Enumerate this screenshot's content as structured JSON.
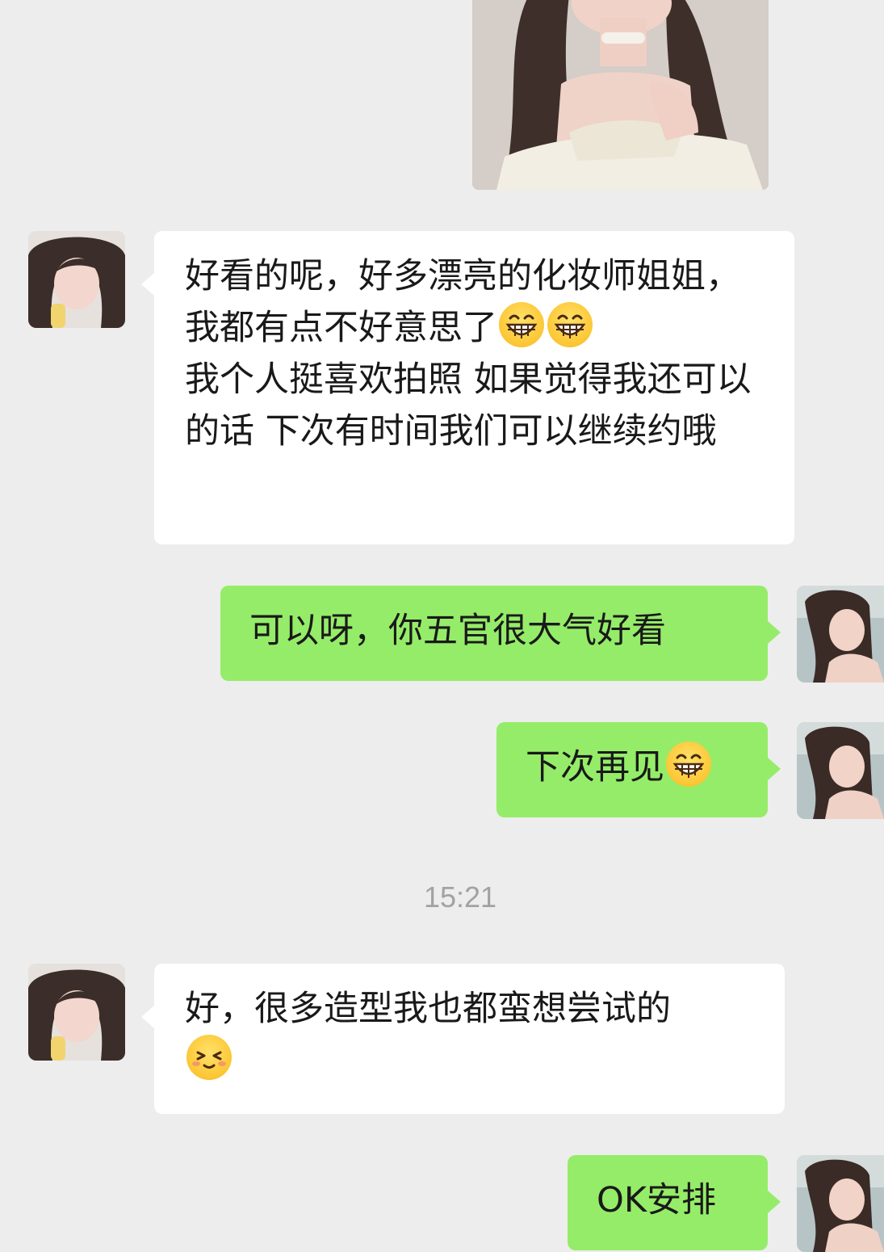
{
  "chat": {
    "messages": [
      {
        "id": "photo-1",
        "type": "image",
        "sender": "me"
      },
      {
        "id": "msg-1",
        "type": "text",
        "sender": "contact",
        "text_part1": "好看的呢，好多漂亮的化妆师姐姐，我都有点不好意思了",
        "emoji": [
          "grinning-emoji",
          "grinning-emoji"
        ],
        "text_part2": "我个人挺喜欢拍照 如果觉得我还可以的话 下次有时间我们可以继续约哦"
      },
      {
        "id": "msg-2",
        "type": "text",
        "sender": "me",
        "text": "可以呀，你五官很大气好看"
      },
      {
        "id": "msg-3",
        "type": "text",
        "sender": "me",
        "text": "下次再见",
        "emoji": [
          "grinning-emoji"
        ]
      },
      {
        "id": "msg-4",
        "type": "text",
        "sender": "contact",
        "text": "好，很多造型我也都蛮想尝试的",
        "emoji": [
          "shy-smile-emoji"
        ]
      },
      {
        "id": "msg-5",
        "type": "text",
        "sender": "me",
        "text": "OK安排"
      }
    ],
    "timestamp": "15:21"
  },
  "colors": {
    "background": "#ededed",
    "incoming_bubble": "#ffffff",
    "outgoing_bubble": "#95ec69",
    "timestamp_text": "#a2a2a2"
  }
}
